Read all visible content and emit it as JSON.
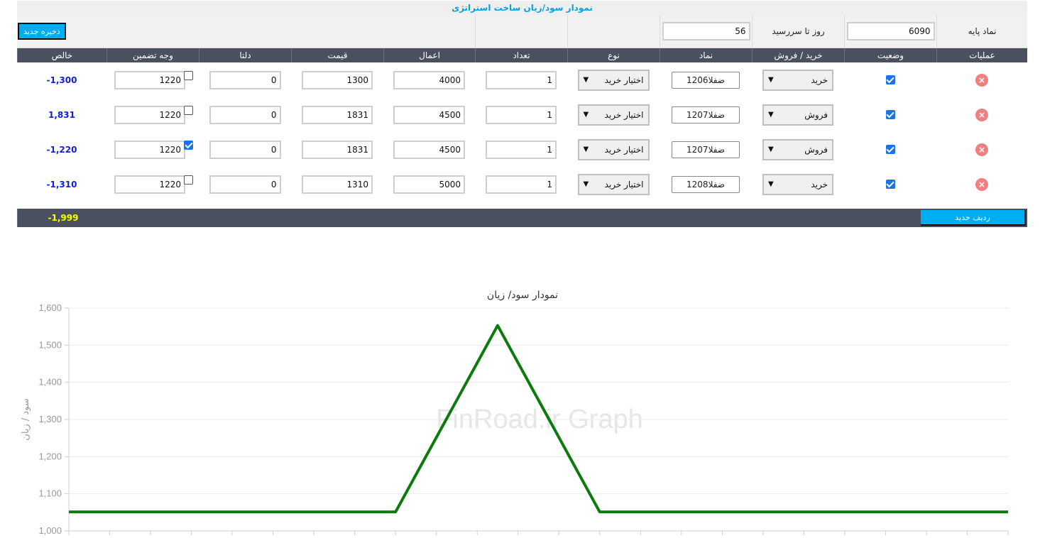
{
  "header": {
    "title": "نمودار سود/زیان ساخت استراتژی"
  },
  "setup": {
    "base_symbol_label": "نماد پایه",
    "base_symbol_value": "6090",
    "days_label": "روز تا سررسید",
    "days_value": "56",
    "save_button": "ذخیره جدید"
  },
  "columns": {
    "ops": "عملیات",
    "status": "وضعیت",
    "side": "خرید / فروش",
    "symbol": "نماد",
    "type": "نوع",
    "qty": "تعداد",
    "strike": "اعمال",
    "price": "قیمت",
    "delta": "دلتا",
    "margin": "وجه تضمین",
    "net": "خالص"
  },
  "rows": [
    {
      "delete_icon": "×",
      "side": "خرید",
      "symbol": "ضفلا1206",
      "type": "اختیار خرید",
      "qty": "1",
      "strike": "4000",
      "price": "1300",
      "delta": "0",
      "margin": "1220",
      "net": "-1,300"
    },
    {
      "delete_icon": "×",
      "side": "فروش",
      "symbol": "ضفلا1207",
      "type": "اختیار خرید",
      "qty": "1",
      "strike": "4500",
      "price": "1831",
      "delta": "0",
      "margin": "1220",
      "net": "1,831"
    },
    {
      "delete_icon": "×",
      "side": "فروش",
      "symbol": "ضفلا1207",
      "type": "اختیار خرید",
      "qty": "1",
      "strike": "4500",
      "price": "1831",
      "delta": "0",
      "margin": "1220",
      "net": "-1,220"
    },
    {
      "delete_icon": "×",
      "side": "خرید",
      "symbol": "ضفلا1208",
      "type": "اختیار خرید",
      "qty": "1",
      "strike": "5000",
      "price": "1310",
      "delta": "0",
      "margin": "1220",
      "net": "-1,310"
    }
  ],
  "row_flags": {
    "status_checked": [
      true,
      true,
      true,
      true
    ],
    "margin_checked": [
      false,
      false,
      true,
      false
    ]
  },
  "footer": {
    "new_row_button": "ردیف جدید",
    "total_net": "-1,999"
  },
  "colors": {
    "accent": "#00aeef",
    "header_bg": "#4b5060",
    "line": "#0d7a0d",
    "net_text": "#1020e0",
    "total_text": "#ffff00"
  },
  "chart_data": {
    "type": "line",
    "title": "نمودار سود/ زیان",
    "ylabel": "سود / زیان",
    "watermark": "FinRoad.ir Graph",
    "ylim": [
      1000,
      1600
    ],
    "yticks": [
      1000,
      1100,
      1200,
      1300,
      1400,
      1500,
      1600
    ],
    "ytick_labels": [
      "1,000",
      "1,100",
      "1,200",
      "1,300",
      "1,400",
      "1,500",
      "1,600"
    ],
    "x_index": [
      0,
      8,
      10.5,
      13,
      23
    ],
    "y": [
      1051,
      1051,
      1553,
      1051,
      1051
    ],
    "grid": true
  }
}
